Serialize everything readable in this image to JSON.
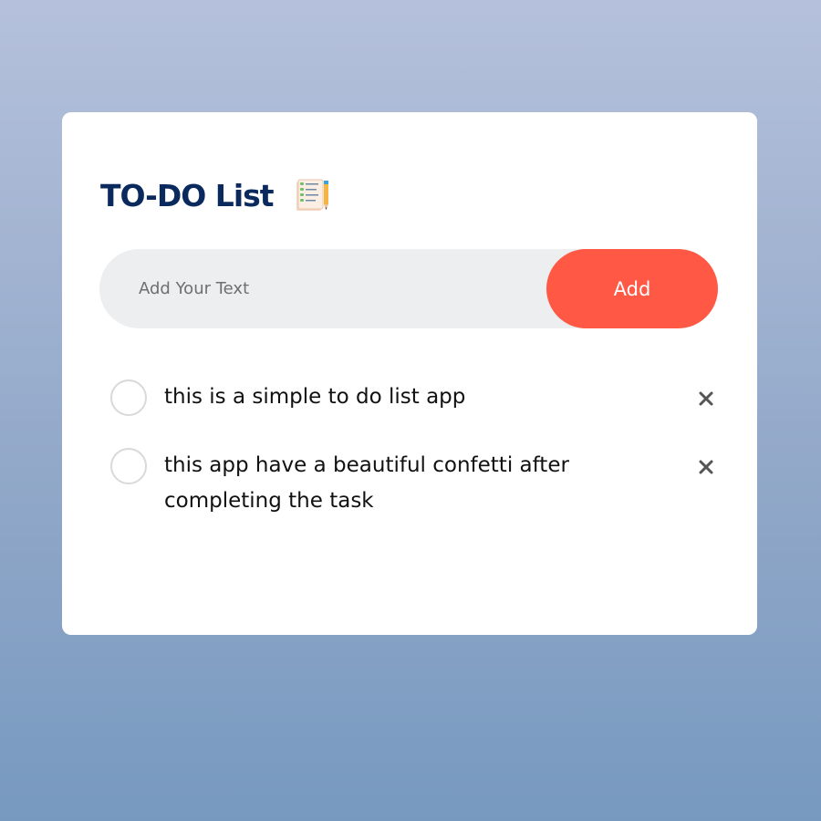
{
  "title": "TO-DO List",
  "title_icon": "checklist-notepad-icon",
  "input": {
    "placeholder": "Add Your Text",
    "value": ""
  },
  "add_button_label": "Add",
  "tasks": [
    {
      "text": "this is a simple to do list app",
      "checked": false
    },
    {
      "text": "this app have a beautiful confetti after completing the task",
      "checked": false
    }
  ],
  "colors": {
    "title": "#0a2a5e",
    "accent": "#ff5945",
    "input_bg": "#edeef0",
    "card_bg": "#ffffff",
    "checkbox_border": "#d9d9d9",
    "delete_icon": "#555555",
    "background_top": "#b5c1dc",
    "background_bottom": "#7799c0"
  }
}
